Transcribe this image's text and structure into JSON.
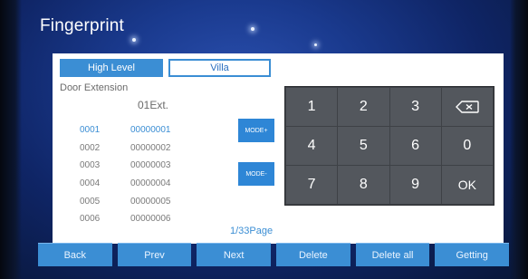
{
  "title": "Fingerprint",
  "tabs": [
    {
      "label": "High Level"
    },
    {
      "label": "Villa"
    }
  ],
  "section_label": "Door Extension",
  "ext_label": "01Ext.",
  "rows": [
    {
      "index": "0001",
      "code": "00000001"
    },
    {
      "index": "0002",
      "code": "00000002"
    },
    {
      "index": "0003",
      "code": "00000003"
    },
    {
      "index": "0004",
      "code": "00000004"
    },
    {
      "index": "0005",
      "code": "00000005"
    },
    {
      "index": "0006",
      "code": "00000006"
    }
  ],
  "mode_buttons": {
    "plus": "MODE+",
    "minus": "MODE-"
  },
  "page_indicator": "1/33Page",
  "keypad": [
    {
      "label": "1"
    },
    {
      "label": "2"
    },
    {
      "label": "3"
    },
    {
      "label": "",
      "icon": "backspace-icon"
    },
    {
      "label": "4"
    },
    {
      "label": "5"
    },
    {
      "label": "6"
    },
    {
      "label": "0"
    },
    {
      "label": "7"
    },
    {
      "label": "8"
    },
    {
      "label": "9"
    },
    {
      "label": "OK"
    }
  ],
  "bottom_buttons": [
    {
      "label": "Back"
    },
    {
      "label": "Prev"
    },
    {
      "label": "Next"
    },
    {
      "label": "Delete"
    },
    {
      "label": "Delete all"
    },
    {
      "label": "Getting"
    }
  ],
  "colors": {
    "accent": "#3b8ed4",
    "keypad": "#53575d",
    "background": "#1a3a8e"
  }
}
